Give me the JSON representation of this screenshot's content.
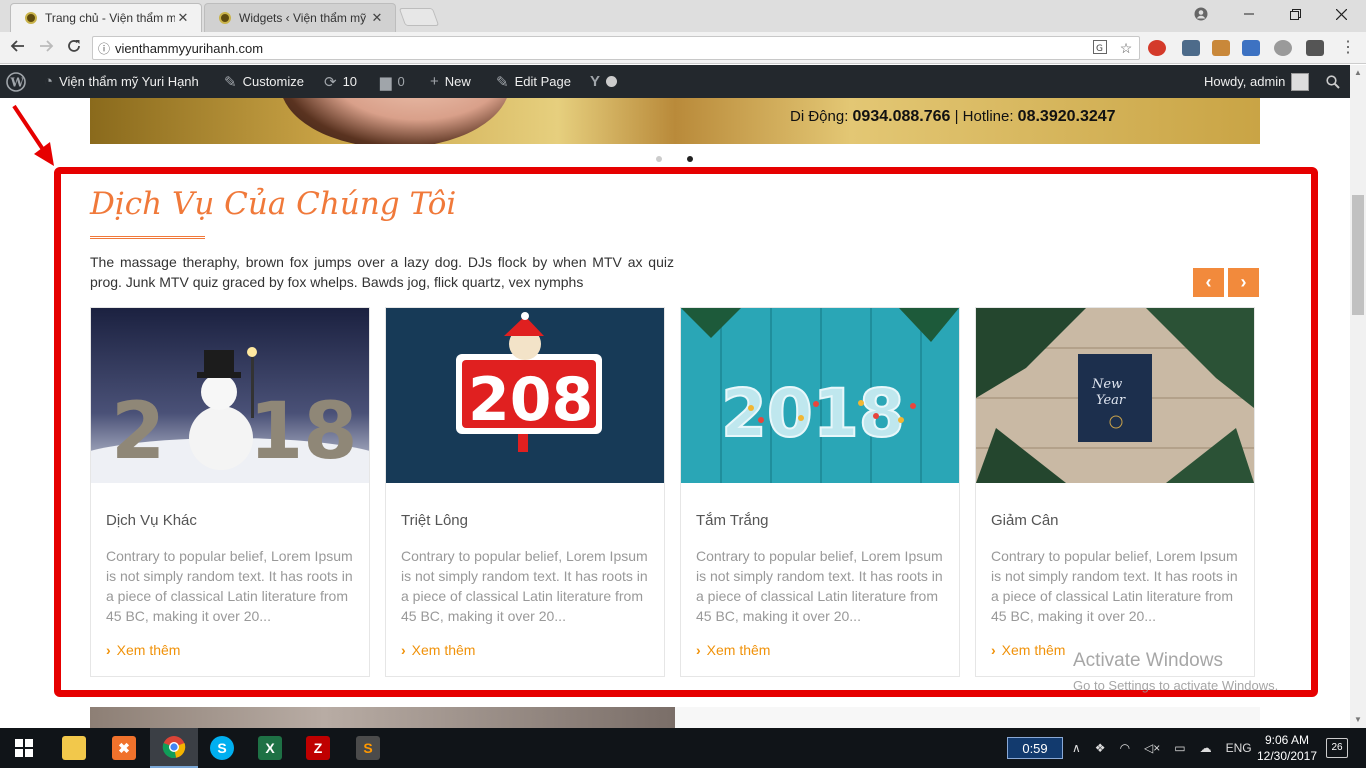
{
  "browser": {
    "tabs": [
      {
        "title": "Trang chủ - Viện thẩm m",
        "close": "✕"
      },
      {
        "title": "Widgets ‹ Viện thẩm mỹ",
        "close": "✕"
      }
    ],
    "url": "vienthammyyurihanh.com"
  },
  "adminbar": {
    "site_name": "Viện thẩm mỹ Yuri Hạnh",
    "customize": "Customize",
    "updates": "10",
    "comments": "0",
    "new": "New",
    "edit_page": "Edit Page",
    "howdy": "Howdy, admin"
  },
  "hero": {
    "contact_prefix": "Di Động: ",
    "mobile": "0934.088.766",
    "separator": "  |  ",
    "hotline_prefix": "Hotline: ",
    "hotline": "08.3920.3247"
  },
  "section": {
    "title": "Dịch Vụ Của Chúng Tôi",
    "description": "The massage theraphy, brown fox jumps over a lazy dog. DJs flock by when MTV ax quiz prog. Junk MTV quiz graced by fox whelps. Bawds jog, flick quartz, vex nymphs",
    "prev": "‹",
    "next": "›"
  },
  "cards": [
    {
      "title": "Dịch Vụ Khác",
      "excerpt": "Contrary to popular belief, Lorem Ipsum is not simply random text. It has roots in a piece of classical Latin literature from 45 BC, making it over 20...",
      "more": "Xem thêm"
    },
    {
      "title": "Triệt Lông",
      "excerpt": "Contrary to popular belief, Lorem Ipsum is not simply random text. It has roots in a piece of classical Latin literature from 45 BC, making it over 20...",
      "more": "Xem thêm"
    },
    {
      "title": "Tắm Trắng",
      "excerpt": "Contrary to popular belief, Lorem Ipsum is not simply random text. It has roots in a piece of classical Latin literature from 45 BC, making it over 20...",
      "more": "Xem thêm"
    },
    {
      "title": "Giảm Cân",
      "excerpt": "Contrary to popular belief, Lorem Ipsum is not simply random text. It has roots in a piece of classical Latin literature from 45 BC, making it over 20...",
      "more": "Xem thêm"
    }
  ],
  "watermark": {
    "line1": "Activate Windows",
    "line2": "Go to Settings to activate Windows."
  },
  "taskbar": {
    "timer": "0:59",
    "language": "ENG",
    "time": "9:06 AM",
    "date": "12/30/2017",
    "notifications": "26"
  },
  "colors": {
    "accent": "#f0793a",
    "highlight": "#e60000",
    "link": "#f0920a"
  }
}
